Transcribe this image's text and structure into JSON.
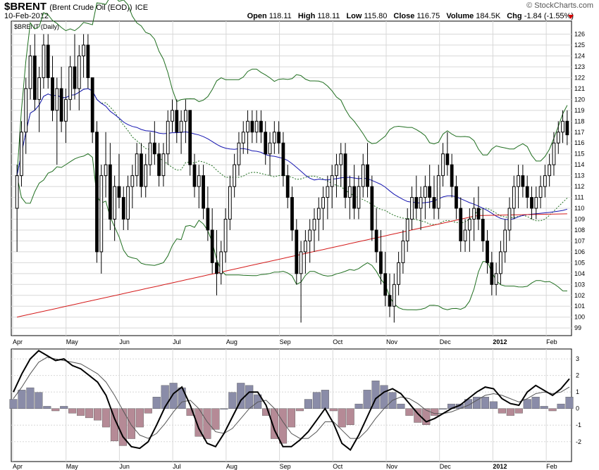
{
  "header": {
    "symbol": "$BRENT",
    "description": "(Brent Crude Oil (EOD))",
    "exchange": "ICE",
    "date": "10-Feb-2012",
    "brand": "© StockCharts.com",
    "open_label": "Open",
    "open": "118.11",
    "high_label": "High",
    "high": "118.11",
    "low_label": "Low",
    "low": "115.80",
    "close_label": "Close",
    "close": "116.75",
    "volume_label": "Volume",
    "volume": "184.5K",
    "chg_label": "Chg",
    "chg": "-1.84 (-1.55%)"
  },
  "price_panel": {
    "legend": "$BRENT (Daily)"
  },
  "colors": {
    "bb": "#1f6e1f",
    "sma50": "#1515b0",
    "sma200": "#d41b1b",
    "ema": "#1f6e1f",
    "hist_pos": "#8a8ca8",
    "hist_neg": "#b58a96",
    "grid": "#d8d8d8",
    "candle": "#000000"
  },
  "chart_data": [
    {
      "type": "candlestick",
      "title": "$BRENT (Daily)",
      "y_ticks": [
        99,
        100,
        101,
        102,
        103,
        104,
        105,
        106,
        107,
        108,
        109,
        110,
        111,
        112,
        113,
        114,
        115,
        116,
        117,
        118,
        119,
        120,
        121,
        122,
        123,
        124,
        125,
        126
      ],
      "ylim": [
        98.3,
        127.2
      ],
      "x_ticks": [
        "Apr",
        "May",
        "Jun",
        "Jul",
        "Aug",
        "Sep",
        "Oct",
        "Nov",
        "Dec",
        "2012",
        "Feb"
      ],
      "overlays": [
        "Bollinger Bands (20,2)",
        "SMA 50",
        "SMA 200",
        "EMA 20"
      ],
      "ohlc": [
        [
          110,
          114,
          106,
          113
        ],
        [
          113,
          118,
          112,
          117
        ],
        [
          117,
          122,
          115,
          121
        ],
        [
          121,
          125,
          120,
          124
        ],
        [
          124,
          126,
          119,
          120
        ],
        [
          120,
          123,
          117,
          122
        ],
        [
          122,
          126,
          121,
          125
        ],
        [
          125,
          126,
          121,
          122
        ],
        [
          122,
          124,
          118,
          119
        ],
        [
          119,
          122,
          114,
          121
        ],
        [
          121,
          123,
          117,
          118
        ],
        [
          118,
          121,
          116,
          120
        ],
        [
          120,
          124,
          119,
          123
        ],
        [
          123,
          126,
          120,
          121
        ],
        [
          121,
          125,
          119,
          124
        ],
        [
          124,
          126,
          122,
          125
        ],
        [
          125,
          126,
          121,
          122
        ],
        [
          122,
          122,
          116,
          117
        ],
        [
          117,
          118,
          105,
          106
        ],
        [
          106,
          114,
          104,
          113
        ],
        [
          113,
          117,
          111,
          114
        ],
        [
          114,
          116,
          108,
          109
        ],
        [
          109,
          113,
          107,
          112
        ],
        [
          112,
          115,
          110,
          111
        ],
        [
          111,
          112,
          108,
          109
        ],
        [
          109,
          113,
          108,
          112
        ],
        [
          112,
          114,
          110,
          113
        ],
        [
          113,
          116,
          112,
          115
        ],
        [
          115,
          116,
          111,
          112
        ],
        [
          112,
          115,
          111,
          114
        ],
        [
          114,
          117,
          113,
          116
        ],
        [
          116,
          118,
          114,
          115
        ],
        [
          115,
          116,
          112,
          113
        ],
        [
          113,
          116,
          112,
          115
        ],
        [
          115,
          119,
          114,
          118
        ],
        [
          118,
          120,
          117,
          119
        ],
        [
          119,
          120,
          116,
          117
        ],
        [
          117,
          119,
          115,
          118
        ],
        [
          118,
          120,
          116,
          119
        ],
        [
          119,
          119,
          113,
          114
        ],
        [
          114,
          115,
          111,
          112
        ],
        [
          112,
          114,
          110,
          113
        ],
        [
          113,
          114,
          109,
          110
        ],
        [
          110,
          112,
          107,
          108
        ],
        [
          108,
          110,
          104,
          105
        ],
        [
          105,
          108,
          102,
          104
        ],
        [
          104,
          107,
          103,
          106
        ],
        [
          106,
          110,
          105,
          109
        ],
        [
          109,
          113,
          108,
          112
        ],
        [
          112,
          115,
          111,
          114
        ],
        [
          114,
          117,
          113,
          116
        ],
        [
          116,
          118,
          115,
          117
        ],
        [
          117,
          119,
          115,
          118
        ],
        [
          118,
          119,
          116,
          117
        ],
        [
          117,
          119,
          116,
          118
        ],
        [
          118,
          119,
          116,
          117
        ],
        [
          117,
          118,
          114,
          115
        ],
        [
          115,
          117,
          113,
          116
        ],
        [
          116,
          118,
          115,
          117
        ],
        [
          117,
          118,
          115,
          116
        ],
        [
          116,
          117,
          112,
          113
        ],
        [
          113,
          114,
          110,
          111
        ],
        [
          111,
          112,
          107,
          108
        ],
        [
          108,
          109,
          103,
          104
        ],
        [
          104,
          107,
          99.5,
          106
        ],
        [
          106,
          108,
          104,
          107
        ],
        [
          107,
          109,
          105,
          108
        ],
        [
          108,
          110,
          106,
          109
        ],
        [
          109,
          111,
          107,
          110
        ],
        [
          110,
          112,
          108,
          111
        ],
        [
          111,
          113,
          109,
          112
        ],
        [
          112,
          114,
          110,
          113
        ],
        [
          113,
          115,
          111,
          114
        ],
        [
          114,
          116,
          112,
          115
        ],
        [
          115,
          116,
          110,
          111
        ],
        [
          111,
          113,
          109,
          112
        ],
        [
          112,
          114,
          109,
          110
        ],
        [
          110,
          113,
          109,
          112
        ],
        [
          112,
          115,
          111,
          114
        ],
        [
          114,
          116,
          111,
          112
        ],
        [
          112,
          113,
          107,
          108
        ],
        [
          108,
          110,
          105,
          106
        ],
        [
          106,
          108,
          103,
          104
        ],
        [
          104,
          106,
          101,
          102
        ],
        [
          102,
          104,
          100,
          101
        ],
        [
          101,
          104,
          99.5,
          103
        ],
        [
          103,
          106,
          102,
          105
        ],
        [
          105,
          108,
          104,
          107
        ],
        [
          107,
          110,
          106,
          109
        ],
        [
          109,
          112,
          108,
          111
        ],
        [
          111,
          113,
          109,
          110
        ],
        [
          110,
          112,
          108,
          111
        ],
        [
          111,
          113,
          109,
          112
        ],
        [
          112,
          114,
          110,
          111
        ],
        [
          111,
          113,
          109,
          110
        ],
        [
          110,
          114,
          109,
          113
        ],
        [
          113,
          116,
          112,
          115
        ],
        [
          115,
          117,
          113,
          114
        ],
        [
          114,
          115,
          111,
          112
        ],
        [
          112,
          113,
          109,
          110
        ],
        [
          110,
          111,
          106,
          107
        ],
        [
          107,
          109,
          106,
          108
        ],
        [
          108,
          110,
          106,
          109
        ],
        [
          109,
          111,
          107,
          110
        ],
        [
          110,
          112,
          108,
          109
        ],
        [
          109,
          110,
          106,
          107
        ],
        [
          107,
          108,
          104,
          105
        ],
        [
          105,
          106,
          102,
          103
        ],
        [
          103,
          105,
          102,
          104
        ],
        [
          104,
          107,
          103,
          106
        ],
        [
          106,
          109,
          105,
          108
        ],
        [
          108,
          111,
          107,
          110
        ],
        [
          110,
          113,
          109,
          112
        ],
        [
          112,
          114,
          110,
          113
        ],
        [
          113,
          114,
          111,
          112
        ],
        [
          112,
          113,
          110,
          111
        ],
        [
          111,
          112,
          109,
          110
        ],
        [
          110,
          112,
          109,
          111
        ],
        [
          111,
          113,
          110,
          112
        ],
        [
          112,
          114,
          111,
          113
        ],
        [
          113,
          115,
          112,
          114
        ],
        [
          114,
          117,
          113,
          116
        ],
        [
          116,
          118,
          115,
          117
        ],
        [
          117,
          119,
          116,
          118
        ],
        [
          118,
          119,
          115.8,
          116.75
        ]
      ]
    },
    {
      "type": "macd",
      "y_ticks": [
        -2,
        -1,
        0,
        1,
        2,
        3
      ],
      "ylim": [
        -3.2,
        3.6
      ],
      "macd": [
        1.0,
        2.1,
        3.0,
        3.5,
        3.2,
        2.9,
        3.0,
        2.6,
        2.4,
        2.0,
        1.6,
        0.8,
        -0.6,
        -1.7,
        -2.3,
        -2.4,
        -2.0,
        -1.0,
        0.1,
        0.9,
        1.3,
        0.2,
        -1.2,
        -2.1,
        -2.3,
        -1.5,
        -0.5,
        0.5,
        1.0,
        1.0,
        0.2,
        -1.3,
        -2.3,
        -2.3,
        -1.9,
        -1.4,
        -0.7,
        0.0,
        -0.9,
        -2.1,
        -2.5,
        -1.6,
        -0.5,
        0.6,
        1.0,
        1.2,
        0.9,
        0.3,
        -0.3,
        -0.8,
        -0.6,
        -0.3,
        0.0,
        0.2,
        0.6,
        1.0,
        1.3,
        1.2,
        0.6,
        0.3,
        0.2,
        1.0,
        1.4,
        1.1,
        0.8,
        1.2,
        1.8
      ],
      "signal": [
        0.6,
        1.3,
        2.1,
        2.8,
        3.1,
        3.0,
        2.9,
        2.8,
        2.7,
        2.4,
        2.1,
        1.6,
        0.8,
        -0.1,
        -1.0,
        -1.6,
        -1.8,
        -1.5,
        -0.9,
        -0.2,
        0.4,
        0.5,
        0.0,
        -0.8,
        -1.4,
        -1.5,
        -1.2,
        -0.6,
        0.0,
        0.4,
        0.5,
        0.0,
        -0.8,
        -1.5,
        -1.8,
        -1.8,
        -1.4,
        -0.8,
        -0.8,
        -1.3,
        -1.8,
        -1.8,
        -1.3,
        -0.6,
        0.0,
        0.5,
        0.7,
        0.6,
        0.3,
        -0.1,
        -0.3,
        -0.3,
        -0.2,
        0.0,
        0.2,
        0.5,
        0.8,
        0.9,
        0.8,
        0.6,
        0.4,
        0.6,
        0.9,
        1.0,
        0.9,
        1.0,
        1.3
      ]
    }
  ]
}
